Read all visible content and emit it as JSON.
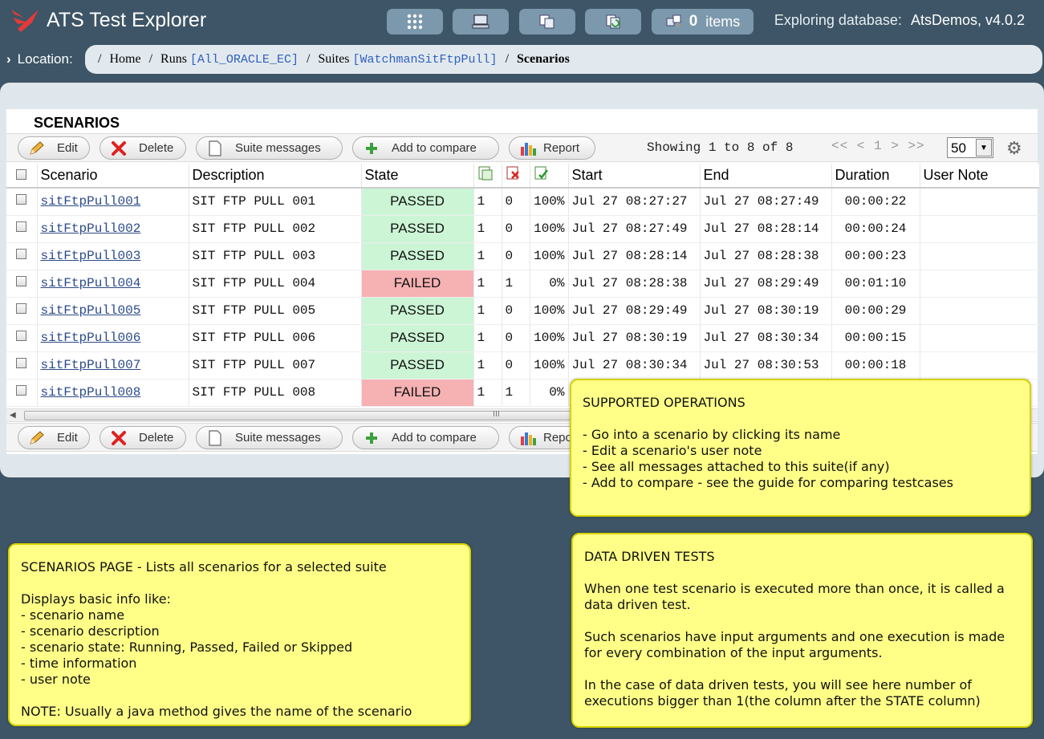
{
  "app": {
    "title": "ATS Test Explorer"
  },
  "topbar": {
    "items_count": "0",
    "items_label": "items",
    "db_label": "Exploring database:",
    "db_value": "AtsDemos, v4.0.2"
  },
  "location": {
    "label": "Location:",
    "crumbs": {
      "home": "Home",
      "runs": "Runs",
      "run_name": "[All_ORACLE_EC]",
      "suites": "Suites",
      "suite_name": "[WatchmanSitFtpPull]",
      "current": "Scenarios"
    }
  },
  "section_title": "SCENARIOS",
  "toolbar": {
    "edit": "Edit",
    "delete": "Delete",
    "suite_messages": "Suite messages",
    "add_to_compare": "Add to compare",
    "report": "Report",
    "report_clipped": "Repo",
    "showing": "Showing 1 to 8 of 8",
    "pager_nav": "<< < 1 > >>",
    "page_size": "50"
  },
  "table": {
    "headers": {
      "scenario": "Scenario",
      "description": "Description",
      "state": "State",
      "start": "Start",
      "end": "End",
      "duration": "Duration",
      "user_note": "User Note"
    },
    "rows": [
      {
        "name": "sitFtpPull001",
        "desc": "SIT FTP PULL 001",
        "state": "PASSED",
        "total": "1",
        "failed": "0",
        "pct": "100%",
        "start": "Jul 27 08:27:27",
        "end": "Jul 27 08:27:49",
        "duration": "00:00:22"
      },
      {
        "name": "sitFtpPull002",
        "desc": "SIT FTP PULL 002",
        "state": "PASSED",
        "total": "1",
        "failed": "0",
        "pct": "100%",
        "start": "Jul 27 08:27:49",
        "end": "Jul 27 08:28:14",
        "duration": "00:00:24"
      },
      {
        "name": "sitFtpPull003",
        "desc": "SIT FTP PULL 003",
        "state": "PASSED",
        "total": "1",
        "failed": "0",
        "pct": "100%",
        "start": "Jul 27 08:28:14",
        "end": "Jul 27 08:28:38",
        "duration": "00:00:23"
      },
      {
        "name": "sitFtpPull004",
        "desc": "SIT FTP PULL 004",
        "state": "FAILED",
        "total": "1",
        "failed": "1",
        "pct": "0%",
        "start": "Jul 27 08:28:38",
        "end": "Jul 27 08:29:49",
        "duration": "00:01:10"
      },
      {
        "name": "sitFtpPull005",
        "desc": "SIT FTP PULL 005",
        "state": "PASSED",
        "total": "1",
        "failed": "0",
        "pct": "100%",
        "start": "Jul 27 08:29:49",
        "end": "Jul 27 08:30:19",
        "duration": "00:00:29"
      },
      {
        "name": "sitFtpPull006",
        "desc": "SIT FTP PULL 006",
        "state": "PASSED",
        "total": "1",
        "failed": "0",
        "pct": "100%",
        "start": "Jul 27 08:30:19",
        "end": "Jul 27 08:30:34",
        "duration": "00:00:15"
      },
      {
        "name": "sitFtpPull007",
        "desc": "SIT FTP PULL 007",
        "state": "PASSED",
        "total": "1",
        "failed": "0",
        "pct": "100%",
        "start": "Jul 27 08:30:34",
        "end": "Jul 27 08:30:53",
        "duration": "00:00:18"
      },
      {
        "name": "sitFtpPull008",
        "desc": "SIT FTP PULL 008",
        "state": "FAILED",
        "total": "1",
        "failed": "1",
        "pct": "0%",
        "start": "",
        "end": "",
        "duration": ""
      }
    ]
  },
  "notes": {
    "operations": "SUPPORTED OPERATIONS\n\n- Go into a scenario by clicking its name\n- Edit a scenario's user note\n- See all messages attached to this suite(if any)\n- Add to compare - see the guide for comparing testcases",
    "page": "SCENARIOS PAGE - Lists all scenarios for a selected suite\n\nDisplays basic info like:\n- scenario name\n- scenario description\n- scenario state: Running, Passed, Failed or Skipped\n- time information\n- user note\n\nNOTE: Usually a java method gives the name of the scenario",
    "data_driven": "DATA DRIVEN TESTS\n\nWhen one test scenario is executed more than once, it is called a data driven test.\n\nSuch scenarios have input arguments and one execution is made for every combination of the input arguments.\n\nIn the case of data driven tests, you will see here number of executions bigger than 1(the column after the STATE column)"
  },
  "colors": {
    "background": "#3d5566",
    "passed": "#ccf5d6",
    "failed": "#f6b1b3",
    "note": "#ffff88",
    "link": "#2b4a8a"
  }
}
